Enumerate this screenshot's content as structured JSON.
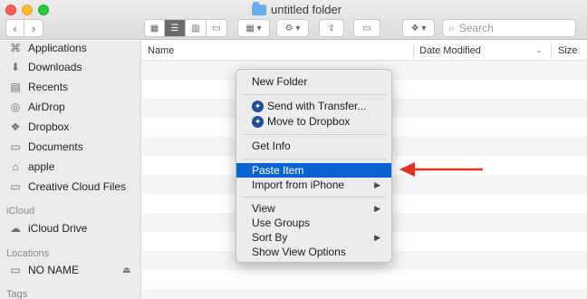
{
  "window": {
    "title": "untitled folder"
  },
  "toolbar": {
    "back_icon": "chevron-left-icon",
    "forward_icon": "chevron-right-icon",
    "search_placeholder": "Search"
  },
  "sidebar": {
    "items": [
      {
        "label": "Applications",
        "icon": "applications-icon"
      },
      {
        "label": "Downloads",
        "icon": "downloads-icon"
      },
      {
        "label": "Recents",
        "icon": "recents-icon"
      },
      {
        "label": "AirDrop",
        "icon": "airdrop-icon"
      },
      {
        "label": "Dropbox",
        "icon": "dropbox-icon"
      },
      {
        "label": "Documents",
        "icon": "documents-icon"
      },
      {
        "label": "apple",
        "icon": "home-icon"
      },
      {
        "label": "Creative Cloud Files",
        "icon": "folder-icon"
      }
    ],
    "icloud_heading": "iCloud",
    "icloud_drive": "iCloud Drive",
    "locations_heading": "Locations",
    "location_item": "NO NAME",
    "tags_heading": "Tags"
  },
  "columns": {
    "name": "Name",
    "date_modified": "Date Modified",
    "size": "Size"
  },
  "context_menu": {
    "new_folder": "New Folder",
    "send_with_transfer": "Send with Transfer...",
    "move_to_dropbox": "Move to Dropbox",
    "get_info": "Get Info",
    "paste_item": "Paste Item",
    "import_from_iphone": "Import from iPhone",
    "view": "View",
    "use_groups": "Use Groups",
    "sort_by": "Sort By",
    "show_view_options": "Show View Options"
  },
  "colors": {
    "highlight": "#0b63d3",
    "annotation_arrow": "#e0321f"
  }
}
